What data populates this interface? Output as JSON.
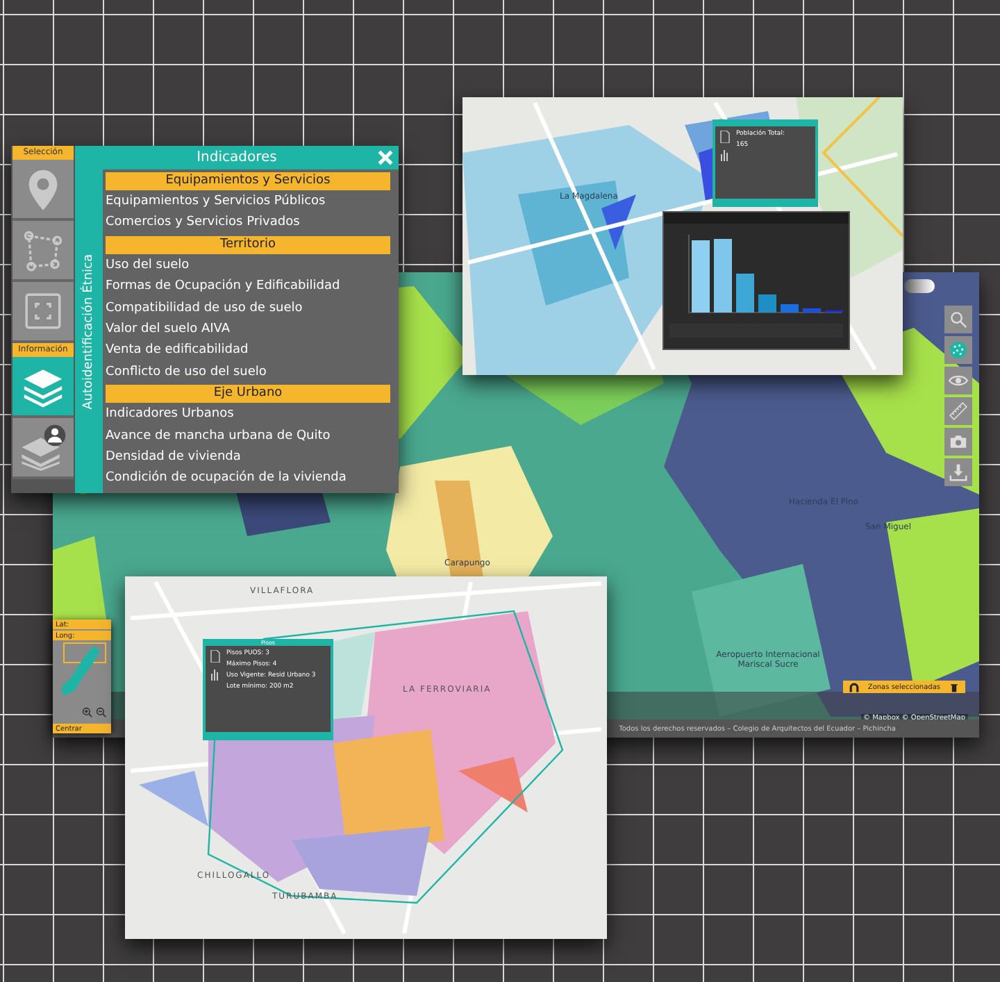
{
  "sidebar": {
    "groups": [
      {
        "label": "Selección",
        "tools": [
          {
            "kind": "pin",
            "selected": false
          },
          {
            "kind": "polygon",
            "selected": false
          },
          {
            "kind": "frame",
            "selected": false
          }
        ]
      },
      {
        "label": "Información",
        "tools": [
          {
            "kind": "layers",
            "selected": true
          },
          {
            "kind": "user-layers",
            "selected": false
          }
        ]
      }
    ]
  },
  "indicators": {
    "title": "Indicadores",
    "vertical_tab": "Autoidentificación Étnica",
    "sections": [
      {
        "title": "Equipamientos y Servicios",
        "items": [
          "Equipamientos y Servicios Públicos",
          "Comercios y Servicios Privados"
        ]
      },
      {
        "title": "Territorio",
        "items": [
          "Uso del suelo",
          "Formas de Ocupación y Edificabilidad",
          "Compatibilidad de uso de suelo",
          "Valor del suelo AIVA",
          "Venta de edificabilidad",
          "Conflicto de uso del suelo"
        ]
      },
      {
        "title": "Eje Urbano",
        "items": [
          "Indicadores Urbanos",
          "Avance de mancha urbana de Quito",
          "Densidad de vivienda",
          "Condición de ocupación de la vivienda"
        ]
      }
    ]
  },
  "main_map": {
    "labels": [
      "Carapungo",
      "San Miguel",
      "Hacienda El Pino",
      "Aeropuerto Internacional Mariscal Sucre"
    ],
    "zones_label": "Zonas seleccionadas",
    "attribution": "© Mapbox © OpenStreetMap",
    "footer": "Todos los derechos reservados – Colegio de Arquitectos del Ecuador – Pichincha"
  },
  "toolbar": {
    "tools": [
      {
        "kind": "search"
      },
      {
        "kind": "texture"
      },
      {
        "kind": "eye"
      },
      {
        "kind": "ruler"
      },
      {
        "kind": "camera"
      },
      {
        "kind": "download"
      }
    ]
  },
  "navigator": {
    "lat_label": "Lat:",
    "long_label": "Long:",
    "center_label": "Centrar"
  },
  "top_view": {
    "labels": [
      "La Magdalena"
    ],
    "popup": {
      "lines": [
        "Población Total:",
        "165"
      ]
    }
  },
  "bottom_view": {
    "labels": [
      "VILLAFLORA",
      "LA FERROVIARIA",
      "CHILLOGALLO",
      "TURUBAMBA"
    ],
    "popup": {
      "title": "Pisos",
      "lines": [
        "Pisos PUOS: 3",
        "Máximo Pisos: 4",
        "Uso Vigente: Resid Urbano 3",
        "Lote mínimo: 200 m2"
      ]
    }
  }
}
